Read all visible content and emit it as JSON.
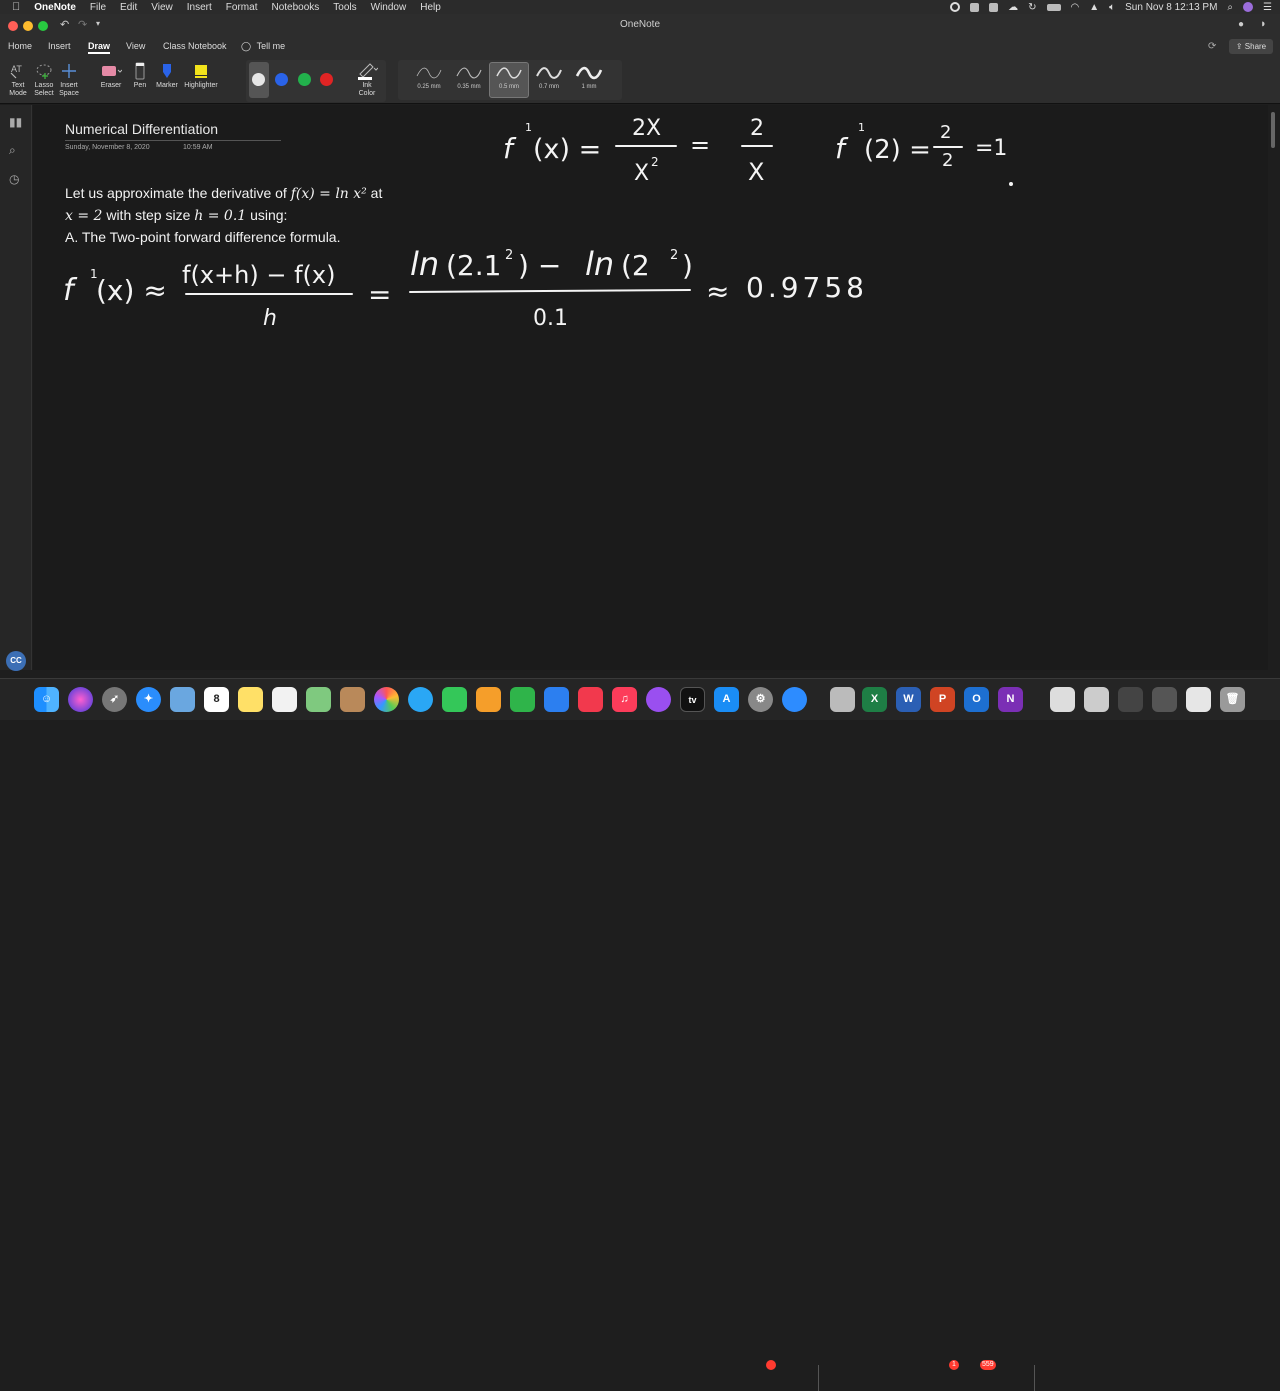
{
  "menubar": {
    "app_name": "OneNote",
    "items": [
      "File",
      "Edit",
      "View",
      "Insert",
      "Format",
      "Notebooks",
      "Tools",
      "Window",
      "Help"
    ],
    "clock": "Sun Nov 8  12:13 PM"
  },
  "window": {
    "title": "OneNote"
  },
  "ribbon": {
    "tabs": [
      "Home",
      "Insert",
      "Draw",
      "View",
      "Class Notebook"
    ],
    "active_tab": "Draw",
    "tell_me": "Tell me",
    "share": "Share"
  },
  "toolbar": {
    "text_mode": [
      "Text",
      "Mode"
    ],
    "lasso_select": [
      "Lasso",
      "Select"
    ],
    "insert_space": [
      "Insert",
      "Space"
    ],
    "eraser": "Eraser",
    "pen": "Pen",
    "marker": "Marker",
    "highlighter": "Highlighter",
    "ink_color": [
      "Ink",
      "Color"
    ],
    "ink_colors": [
      "#e6e6e6",
      "#2a63e8",
      "#22b14c",
      "#e02424"
    ],
    "pen_sizes": [
      "0.25 mm",
      "0.35 mm",
      "0.5 mm",
      "0.7 mm",
      "1 mm"
    ],
    "selected_pen_size": "0.5 mm"
  },
  "page": {
    "title": "Numerical Differentiation",
    "date": "Sunday, November 8, 2020",
    "time": "10:59 AM",
    "problem": {
      "line1_prefix": "Let us approximate the derivative of ",
      "line1_math": "f(x) = ln x²",
      "line1_suffix": " at",
      "line2_math_a": "x = 2",
      "line2_mid": " with step size ",
      "line2_math_b": "h = 0.1",
      "line2_suffix": " using:",
      "line3": "A.  The Two-point forward difference formula."
    },
    "ink": {
      "derivative_top": "f′(x) = 2x / x² = 2 / x",
      "derivative_at_2": "f′(2) = 2/2 = 1",
      "formula": "f′(x) ≈ (f(x+h) − f(x)) / h = (ln(2.1²) − ln(2²)) / 0.1 ≈ 0.9758",
      "result": "0.9758"
    }
  },
  "sidebar": {
    "captions": "CC"
  },
  "dock": {
    "apps": [
      "Finder",
      "Siri",
      "Launchpad",
      "Safari",
      "Preview",
      "Calendar",
      "Notes",
      "Reminders",
      "Maps",
      "Contacts",
      "Photos",
      "Messages",
      "FaceTime",
      "Pages",
      "Numbers",
      "Keynote",
      "News",
      "Music",
      "Podcasts",
      "TV",
      "App Store",
      "System Preferences",
      "Zoom",
      "Screenshot",
      "Excel",
      "Word",
      "PowerPoint",
      "Outlook",
      "OneNote",
      "Documents",
      "Downloads",
      "Trash"
    ],
    "calendar_day": "8",
    "badges": {
      "powerpoint": "1",
      "outlook": "559"
    }
  }
}
